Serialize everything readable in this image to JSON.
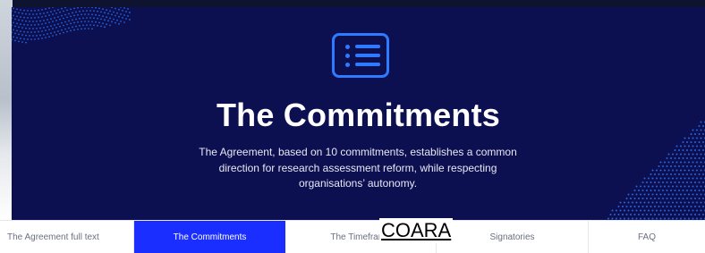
{
  "hero": {
    "icon": "list-icon",
    "title": "The Commitments",
    "description_lines": [
      "The Agreement, based on 10 commitments, establishes a common",
      "direction for research assessment reform, while respecting",
      "organisations’ autonomy."
    ]
  },
  "tabs": [
    {
      "label": "The Agreement full text",
      "active": false
    },
    {
      "label": "The Commitments",
      "active": true
    },
    {
      "label": "The Timeframe",
      "active": false
    },
    {
      "label": "Signatories",
      "active": false
    },
    {
      "label": "FAQ",
      "active": false
    }
  ],
  "overlay": {
    "label": "COARA"
  },
  "colors": {
    "hero_bg": "#0d1050",
    "accent": "#1a2fff",
    "icon_blue": "#2f7bff",
    "text_white": "#ffffff"
  }
}
